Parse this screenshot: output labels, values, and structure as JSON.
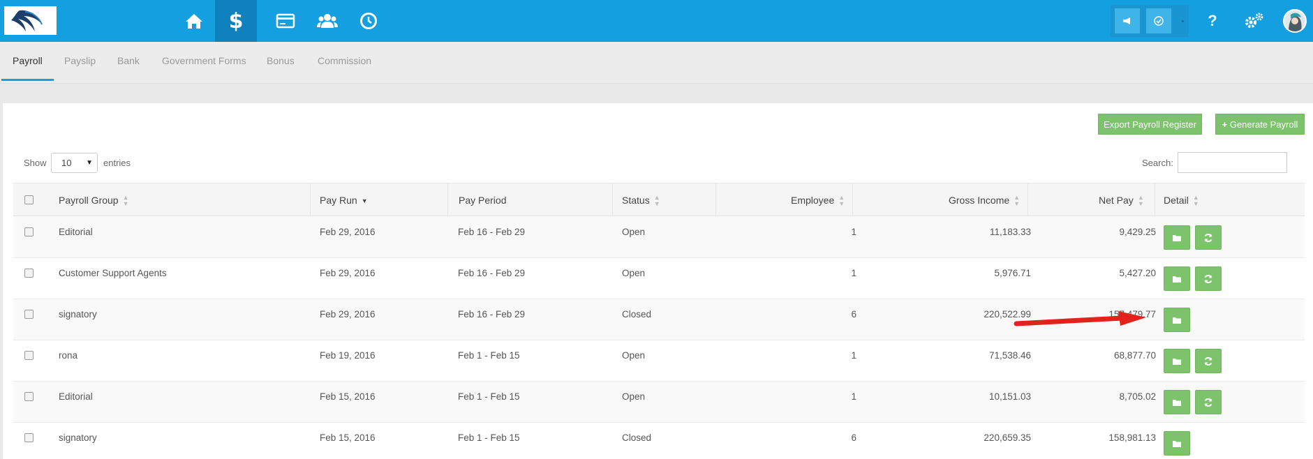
{
  "nav": {
    "icons": [
      "home-icon",
      "dollar-icon",
      "credit-card-icon",
      "users-icon",
      "clock-icon"
    ],
    "active": "dollar-icon",
    "right_icons": [
      "megaphone-icon",
      "check-circle-icon",
      "help-icon",
      "gears-icon"
    ]
  },
  "tabs": [
    {
      "label": "Payroll",
      "active": true
    },
    {
      "label": "Payslip",
      "active": false
    },
    {
      "label": "Bank",
      "active": false
    },
    {
      "label": "Government Forms",
      "active": false
    },
    {
      "label": "Bonus",
      "active": false
    },
    {
      "label": "Commission",
      "active": false
    }
  ],
  "actions": {
    "export_label": "Export Payroll Register",
    "generate_label": "Generate Payroll"
  },
  "length": {
    "show_label": "Show",
    "value": "10",
    "entries_label": "entries"
  },
  "search": {
    "label": "Search:",
    "value": ""
  },
  "table": {
    "headers": {
      "payroll_group": "Payroll Group",
      "pay_run": "Pay Run",
      "pay_period": "Pay Period",
      "status": "Status",
      "employee": "Employee",
      "gross_income": "Gross Income",
      "net_pay": "Net Pay",
      "detail": "Detail"
    },
    "sorted_column": "pay_run",
    "rows": [
      {
        "payroll_group": "Editorial",
        "pay_run": "Feb 29, 2016",
        "pay_period": "Feb 16 - Feb 29",
        "status": "Open",
        "employee": "1",
        "gross_income": "11,183.33",
        "net_pay": "9,429.25",
        "has_refresh": true
      },
      {
        "payroll_group": "Customer Support Agents",
        "pay_run": "Feb 29, 2016",
        "pay_period": "Feb 16 - Feb 29",
        "status": "Open",
        "employee": "1",
        "gross_income": "5,976.71",
        "net_pay": "5,427.20",
        "has_refresh": true
      },
      {
        "payroll_group": "signatory",
        "pay_run": "Feb 29, 2016",
        "pay_period": "Feb 16 - Feb 29",
        "status": "Closed",
        "employee": "6",
        "gross_income": "220,522.99",
        "net_pay": "157,479.77",
        "has_refresh": false
      },
      {
        "payroll_group": "rona",
        "pay_run": "Feb 19, 2016",
        "pay_period": "Feb 1 - Feb 15",
        "status": "Open",
        "employee": "1",
        "gross_income": "71,538.46",
        "net_pay": "68,877.70",
        "has_refresh": true
      },
      {
        "payroll_group": "Editorial",
        "pay_run": "Feb 15, 2016",
        "pay_period": "Feb 1 - Feb 15",
        "status": "Open",
        "employee": "1",
        "gross_income": "10,151.03",
        "net_pay": "8,705.02",
        "has_refresh": true
      },
      {
        "payroll_group": "signatory",
        "pay_run": "Feb 15, 2016",
        "pay_period": "Feb 1 - Feb 15",
        "status": "Closed",
        "employee": "6",
        "gross_income": "220,659.35",
        "net_pay": "158,981.13",
        "has_refresh": false
      }
    ]
  },
  "colors": {
    "topbar": "#139fe0",
    "active_nav": "#0f82be",
    "green_button": "#7dc36b",
    "arrow": "#e3231b"
  }
}
